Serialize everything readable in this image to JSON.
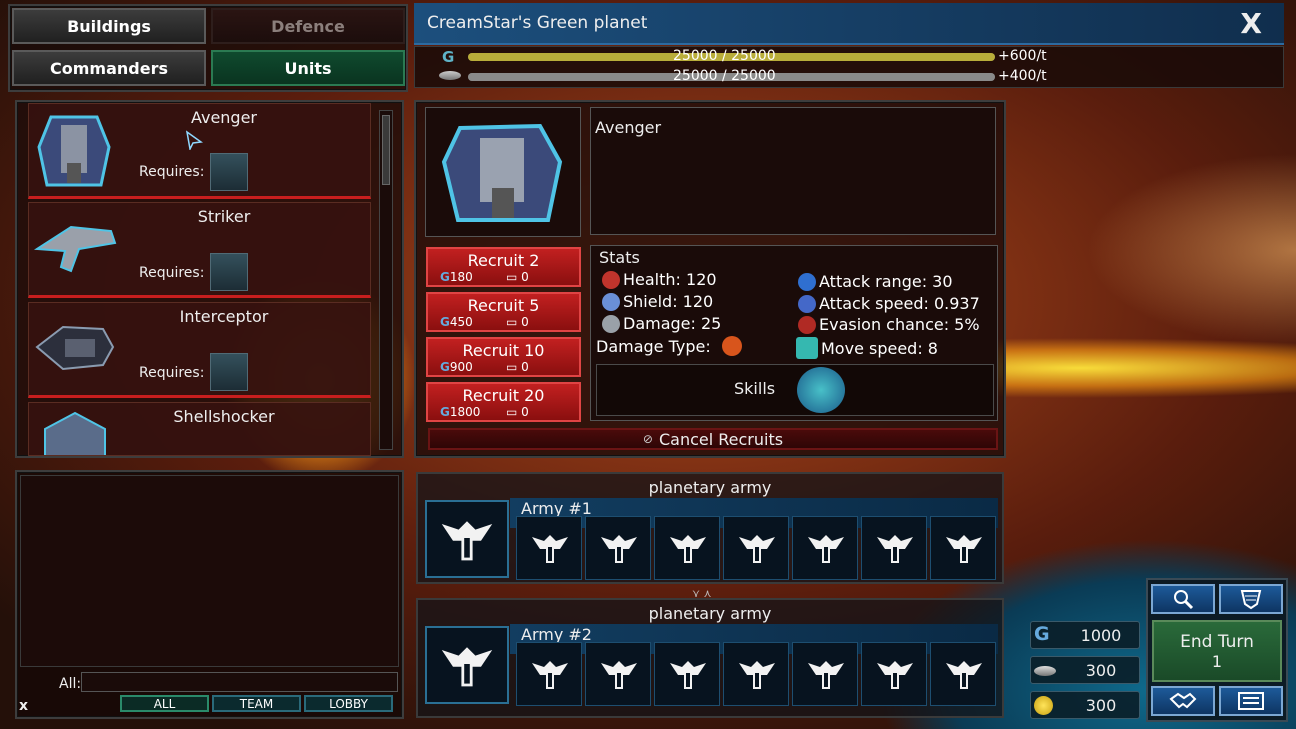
{
  "tabs": {
    "buildings": "Buildings",
    "defence": "Defence",
    "commanders": "Commanders",
    "units": "Units"
  },
  "planet": {
    "title": "CreamStar's Green planet",
    "close": "X",
    "resources": [
      {
        "icon": "g-credit-icon",
        "value": "25000 / 25000",
        "rate": "+600/t",
        "fill": 1.0,
        "color": "#b9ad3a"
      },
      {
        "icon": "ore-icon",
        "value": "25000 / 25000",
        "rate": "+400/t",
        "fill": 1.0,
        "color": "#8a8a8a"
      }
    ]
  },
  "units_list": [
    {
      "name": "Avenger",
      "requires": "Requires:"
    },
    {
      "name": "Striker",
      "requires": "Requires:"
    },
    {
      "name": "Interceptor",
      "requires": "Requires:"
    },
    {
      "name": "Shellshocker",
      "requires": "Requires:"
    }
  ],
  "detail": {
    "name": "Avenger",
    "recruit": [
      {
        "label": "Recruit 2",
        "credits": "180",
        "ore": "0"
      },
      {
        "label": "Recruit 5",
        "credits": "450",
        "ore": "0"
      },
      {
        "label": "Recruit 10",
        "credits": "900",
        "ore": "0"
      },
      {
        "label": "Recruit 20",
        "credits": "1800",
        "ore": "0"
      }
    ],
    "stats_title": "Stats",
    "stats_left": [
      {
        "label": "Health: 120",
        "icon": "health-icon",
        "color": "#c0342c"
      },
      {
        "label": "Shield: 120",
        "icon": "shield-icon",
        "color": "#6a8fd6"
      },
      {
        "label": "Damage: 25",
        "icon": "damage-icon",
        "color": "#9aa1a8"
      }
    ],
    "stats_right": [
      {
        "label": "Attack range: 30",
        "icon": "range-icon",
        "color": "#2f6fd0"
      },
      {
        "label": "Attack speed: 0.937",
        "icon": "speed-icon",
        "color": "#4468c8"
      },
      {
        "label": "Evasion chance: 5%",
        "icon": "evasion-icon",
        "color": "#b02a24"
      },
      {
        "label": "Move speed: 8",
        "icon": "move-icon",
        "color": "#35b8b0"
      }
    ],
    "damage_type": "Damage Type:",
    "skills": "Skills",
    "cancel": "Cancel Recruits"
  },
  "armies": [
    {
      "header": "planetary army",
      "name": "Army #1"
    },
    {
      "header": "planetary army",
      "name": "Army #2"
    }
  ],
  "chat": {
    "all_label": "All:",
    "buttons": [
      "ALL",
      "TEAM",
      "LOBBY"
    ],
    "close": "x"
  },
  "bottom": {
    "end_turn": "End Turn",
    "turn_number": "1",
    "credits": "1000",
    "ore": "300",
    "gold": "300"
  }
}
